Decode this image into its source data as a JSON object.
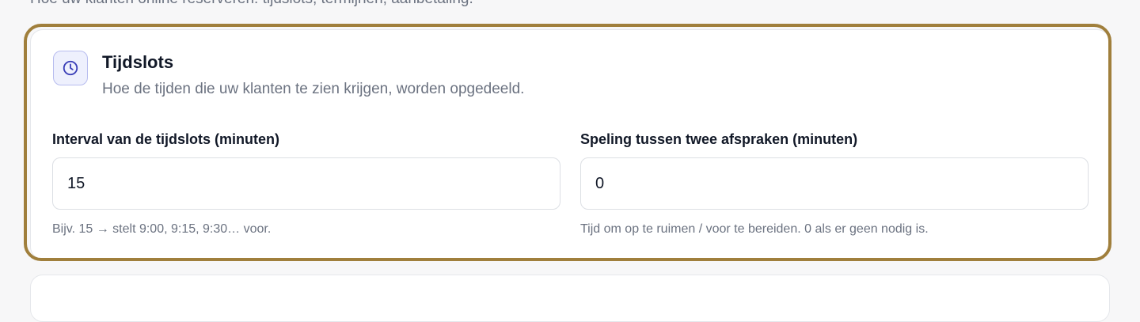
{
  "intro_text": "Hoe uw klanten online reserveren: tijdslots, termijnen, aanbetaling.",
  "card": {
    "icon": "clock-icon",
    "title": "Tijdslots",
    "subtitle": "Hoe de tijden die uw klanten te zien krijgen, worden opgedeeld."
  },
  "fields": {
    "interval": {
      "label": "Interval van de tijdslots (minuten)",
      "value": "15",
      "help": "Bijv. 15 → stelt 9:00, 9:15, 9:30… voor."
    },
    "buffer": {
      "label": "Speling tussen twee afspraken (minuten)",
      "value": "0",
      "help": "Tijd om op te ruimen / voor te bereiden. 0 als er geen nodig is."
    }
  },
  "colors": {
    "highlight_border": "#a07f3c",
    "icon_accent": "#3b3fb8",
    "icon_bg": "#eef0fd"
  }
}
